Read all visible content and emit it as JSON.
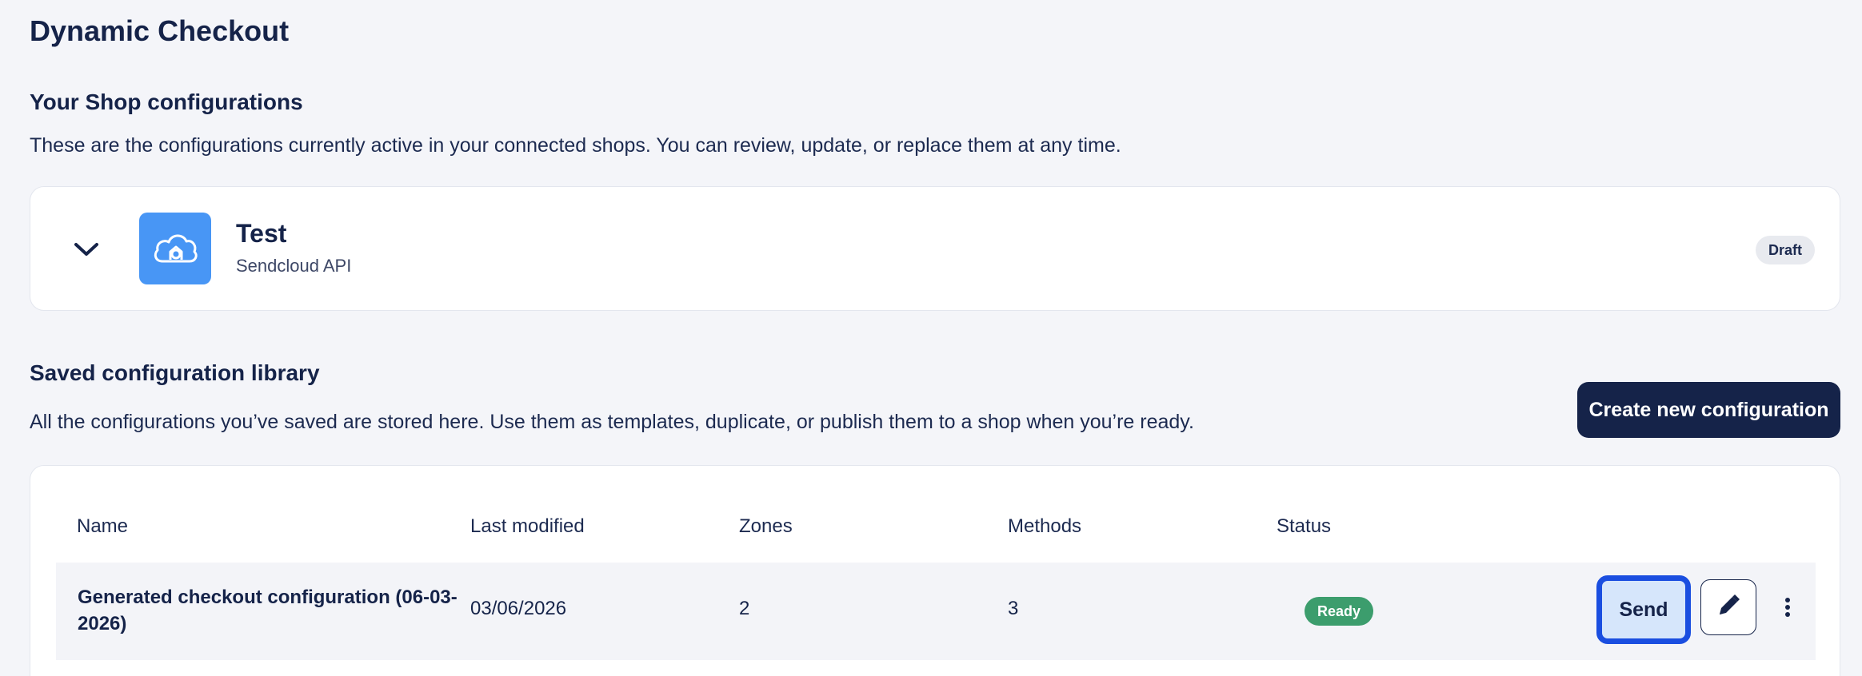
{
  "page": {
    "title": "Dynamic Checkout"
  },
  "shop_section": {
    "title": "Your Shop configurations",
    "description": "These are the configurations currently active in your connected shops. You can review, update, or replace them at any time.",
    "shop": {
      "name": "Test",
      "integration": "Sendcloud API",
      "status": "Draft",
      "logo_color": "#4896f5"
    }
  },
  "library_section": {
    "title": "Saved configuration library",
    "description": "All the configurations you’ve saved are stored here. Use them as templates, duplicate, or publish them to a shop when you’re ready.",
    "create_button": "Create new configuration",
    "table": {
      "columns": [
        "Name",
        "Last modified",
        "Zones",
        "Methods",
        "Status"
      ],
      "rows": [
        {
          "name": "Generated checkout configuration (06-03-2026)",
          "last_modified": "03/06/2026",
          "zones": "2",
          "methods": "3",
          "status": "Ready",
          "actions": {
            "send": "Send",
            "edit_icon": "pencil-icon",
            "more_icon": "more-vertical-icon"
          }
        }
      ]
    }
  },
  "colors": {
    "primary": "#152349",
    "ready": "#3c9d6d",
    "focus": "#1a4ee0",
    "background": "#f4f5f9"
  }
}
